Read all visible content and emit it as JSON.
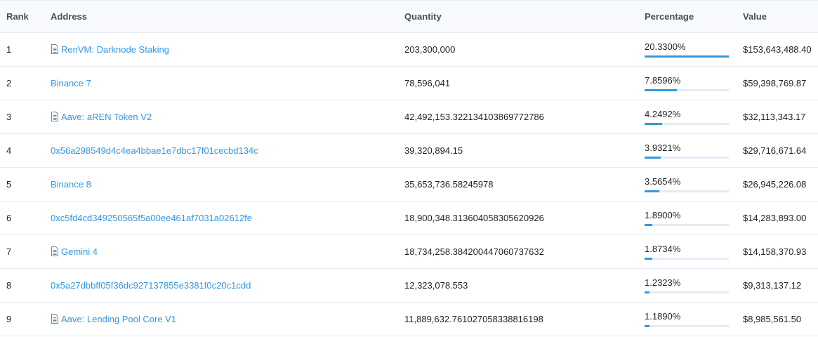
{
  "headers": {
    "rank": "Rank",
    "address": "Address",
    "quantity": "Quantity",
    "percentage": "Percentage",
    "value": "Value"
  },
  "colors": {
    "link": "#3498db",
    "bar_fill": "#3498db",
    "bar_track": "#e7eaf3"
  },
  "rows": [
    {
      "rank": "1",
      "address": "RenVM: Darknode Staking",
      "contract_icon": true,
      "quantity": "203,300,000",
      "percentage": "20.3300%",
      "pct_value": 20.33,
      "value": "$153,643,488.40"
    },
    {
      "rank": "2",
      "address": "Binance 7",
      "contract_icon": false,
      "quantity": "78,596,041",
      "percentage": "7.8596%",
      "pct_value": 7.8596,
      "value": "$59,398,769.87"
    },
    {
      "rank": "3",
      "address": "Aave: aREN Token V2",
      "contract_icon": true,
      "quantity": "42,492,153.322134103869772786",
      "percentage": "4.2492%",
      "pct_value": 4.2492,
      "value": "$32,113,343.17"
    },
    {
      "rank": "4",
      "address": "0x56a298549d4c4ea4bbae1e7dbc17f01cecbd134c",
      "contract_icon": false,
      "quantity": "39,320,894.15",
      "percentage": "3.9321%",
      "pct_value": 3.9321,
      "value": "$29,716,671.64"
    },
    {
      "rank": "5",
      "address": "Binance 8",
      "contract_icon": false,
      "quantity": "35,653,736.58245978",
      "percentage": "3.5654%",
      "pct_value": 3.5654,
      "value": "$26,945,226.08"
    },
    {
      "rank": "6",
      "address": "0xc5fd4cd349250565f5a00ee461af7031a02612fe",
      "contract_icon": false,
      "quantity": "18,900,348.313604058305620926",
      "percentage": "1.8900%",
      "pct_value": 1.89,
      "value": "$14,283,893.00"
    },
    {
      "rank": "7",
      "address": "Gemini 4",
      "contract_icon": true,
      "quantity": "18,734,258.384200447060737632",
      "percentage": "1.8734%",
      "pct_value": 1.8734,
      "value": "$14,158,370.93"
    },
    {
      "rank": "8",
      "address": "0x5a27dbbff05f36dc927137855e3381f0c20c1cdd",
      "contract_icon": false,
      "quantity": "12,323,078.553",
      "percentage": "1.2323%",
      "pct_value": 1.2323,
      "value": "$9,313,137.12"
    },
    {
      "rank": "9",
      "address": "Aave: Lending Pool Core V1",
      "contract_icon": true,
      "quantity": "11,889,632.761027058338816198",
      "percentage": "1.1890%",
      "pct_value": 1.189,
      "value": "$8,985,561.50"
    }
  ]
}
